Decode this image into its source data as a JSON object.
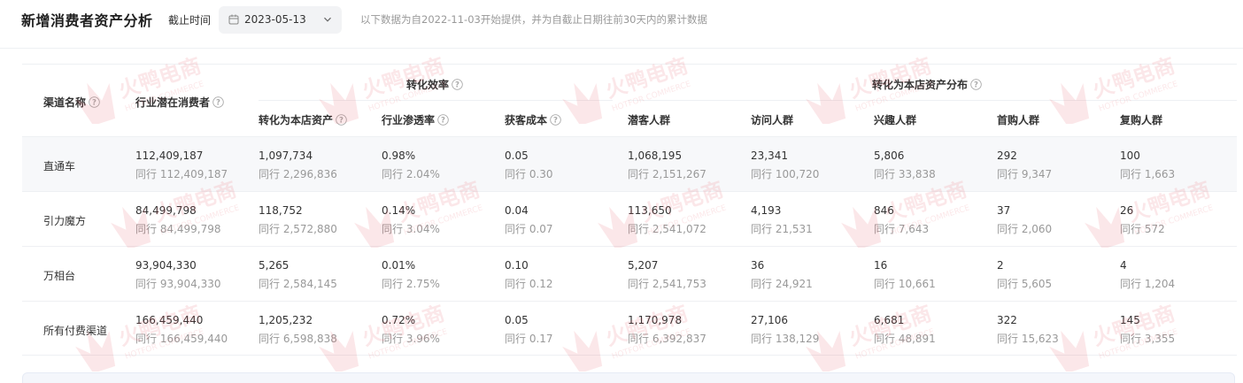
{
  "header": {
    "title": "新增消费者资产分析",
    "date_label": "截止时间",
    "date_value": "2023-05-13",
    "notice": "以下数据为自2022-11-03开始提供，并为自截止日期往前30天内的累计数据"
  },
  "table": {
    "group_efficiency": "转化效率",
    "group_distribution": "转化为本店资产分布",
    "columns": {
      "channel": "渠道名称",
      "potential": "行业潜在消费者",
      "converted": "转化为本店资产",
      "penetration": "行业渗透率",
      "cost": "获客成本",
      "prospect": "潜客人群",
      "visit": "访问人群",
      "interest": "兴趣人群",
      "first_buy": "首购人群",
      "repurchase": "复购人群"
    },
    "rows": [
      {
        "name": "直通车",
        "cells": [
          {
            "v": "112,409,187",
            "s": "同行 112,409,187"
          },
          {
            "v": "1,097,734",
            "s": "同行 2,296,836"
          },
          {
            "v": "0.98%",
            "s": "同行 2.04%"
          },
          {
            "v": "0.05",
            "s": "同行 0.30"
          },
          {
            "v": "1,068,195",
            "s": "同行 2,151,267"
          },
          {
            "v": "23,341",
            "s": "同行 100,720"
          },
          {
            "v": "5,806",
            "s": "同行 33,838"
          },
          {
            "v": "292",
            "s": "同行 9,347"
          },
          {
            "v": "100",
            "s": "同行 1,663"
          }
        ]
      },
      {
        "name": "引力魔方",
        "cells": [
          {
            "v": "84,499,798",
            "s": "同行 84,499,798"
          },
          {
            "v": "118,752",
            "s": "同行 2,572,880"
          },
          {
            "v": "0.14%",
            "s": "同行 3.04%"
          },
          {
            "v": "0.04",
            "s": "同行 0.07"
          },
          {
            "v": "113,650",
            "s": "同行 2,541,072"
          },
          {
            "v": "4,193",
            "s": "同行 21,531"
          },
          {
            "v": "846",
            "s": "同行 7,643"
          },
          {
            "v": "37",
            "s": "同行 2,060"
          },
          {
            "v": "26",
            "s": "同行 572"
          }
        ]
      },
      {
        "name": "万相台",
        "cells": [
          {
            "v": "93,904,330",
            "s": "同行 93,904,330"
          },
          {
            "v": "5,265",
            "s": "同行 2,584,145"
          },
          {
            "v": "0.01%",
            "s": "同行 2.75%"
          },
          {
            "v": "0.10",
            "s": "同行 0.12"
          },
          {
            "v": "5,207",
            "s": "同行 2,541,753"
          },
          {
            "v": "36",
            "s": "同行 24,921"
          },
          {
            "v": "16",
            "s": "同行 10,661"
          },
          {
            "v": "2",
            "s": "同行 5,605"
          },
          {
            "v": "4",
            "s": "同行 1,204"
          }
        ]
      },
      {
        "name": "所有付费渠道",
        "cells": [
          {
            "v": "166,459,440",
            "s": "同行 166,459,440"
          },
          {
            "v": "1,205,232",
            "s": "同行 6,598,838"
          },
          {
            "v": "0.72%",
            "s": "同行 3.96%"
          },
          {
            "v": "0.05",
            "s": "同行 0.17"
          },
          {
            "v": "1,170,978",
            "s": "同行 6,392,837"
          },
          {
            "v": "27,106",
            "s": "同行 138,129"
          },
          {
            "v": "6,681",
            "s": "同行 48,891"
          },
          {
            "v": "322",
            "s": "同行 15,623"
          },
          {
            "v": "145",
            "s": "同行 3,355"
          }
        ]
      }
    ]
  },
  "watermark": {
    "text_cn": "火鸭电商",
    "text_en": "HOTFOR COMMERCE",
    "color": "#e8505b"
  }
}
